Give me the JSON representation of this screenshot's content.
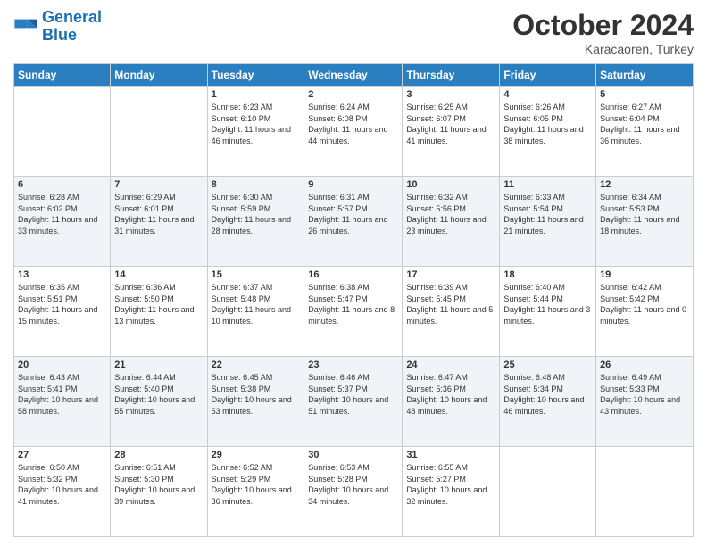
{
  "logo": {
    "line1": "General",
    "line2": "Blue"
  },
  "title": "October 2024",
  "location": "Karacaoren, Turkey",
  "days_of_week": [
    "Sunday",
    "Monday",
    "Tuesday",
    "Wednesday",
    "Thursday",
    "Friday",
    "Saturday"
  ],
  "weeks": [
    [
      {
        "day": null
      },
      {
        "day": null
      },
      {
        "day": 1,
        "sunrise": "6:23 AM",
        "sunset": "6:10 PM",
        "daylight": "11 hours and 46 minutes."
      },
      {
        "day": 2,
        "sunrise": "6:24 AM",
        "sunset": "6:08 PM",
        "daylight": "11 hours and 44 minutes."
      },
      {
        "day": 3,
        "sunrise": "6:25 AM",
        "sunset": "6:07 PM",
        "daylight": "11 hours and 41 minutes."
      },
      {
        "day": 4,
        "sunrise": "6:26 AM",
        "sunset": "6:05 PM",
        "daylight": "11 hours and 38 minutes."
      },
      {
        "day": 5,
        "sunrise": "6:27 AM",
        "sunset": "6:04 PM",
        "daylight": "11 hours and 36 minutes."
      }
    ],
    [
      {
        "day": 6,
        "sunrise": "6:28 AM",
        "sunset": "6:02 PM",
        "daylight": "11 hours and 33 minutes."
      },
      {
        "day": 7,
        "sunrise": "6:29 AM",
        "sunset": "6:01 PM",
        "daylight": "11 hours and 31 minutes."
      },
      {
        "day": 8,
        "sunrise": "6:30 AM",
        "sunset": "5:59 PM",
        "daylight": "11 hours and 28 minutes."
      },
      {
        "day": 9,
        "sunrise": "6:31 AM",
        "sunset": "5:57 PM",
        "daylight": "11 hours and 26 minutes."
      },
      {
        "day": 10,
        "sunrise": "6:32 AM",
        "sunset": "5:56 PM",
        "daylight": "11 hours and 23 minutes."
      },
      {
        "day": 11,
        "sunrise": "6:33 AM",
        "sunset": "5:54 PM",
        "daylight": "11 hours and 21 minutes."
      },
      {
        "day": 12,
        "sunrise": "6:34 AM",
        "sunset": "5:53 PM",
        "daylight": "11 hours and 18 minutes."
      }
    ],
    [
      {
        "day": 13,
        "sunrise": "6:35 AM",
        "sunset": "5:51 PM",
        "daylight": "11 hours and 15 minutes."
      },
      {
        "day": 14,
        "sunrise": "6:36 AM",
        "sunset": "5:50 PM",
        "daylight": "11 hours and 13 minutes."
      },
      {
        "day": 15,
        "sunrise": "6:37 AM",
        "sunset": "5:48 PM",
        "daylight": "11 hours and 10 minutes."
      },
      {
        "day": 16,
        "sunrise": "6:38 AM",
        "sunset": "5:47 PM",
        "daylight": "11 hours and 8 minutes."
      },
      {
        "day": 17,
        "sunrise": "6:39 AM",
        "sunset": "5:45 PM",
        "daylight": "11 hours and 5 minutes."
      },
      {
        "day": 18,
        "sunrise": "6:40 AM",
        "sunset": "5:44 PM",
        "daylight": "11 hours and 3 minutes."
      },
      {
        "day": 19,
        "sunrise": "6:42 AM",
        "sunset": "5:42 PM",
        "daylight": "11 hours and 0 minutes."
      }
    ],
    [
      {
        "day": 20,
        "sunrise": "6:43 AM",
        "sunset": "5:41 PM",
        "daylight": "10 hours and 58 minutes."
      },
      {
        "day": 21,
        "sunrise": "6:44 AM",
        "sunset": "5:40 PM",
        "daylight": "10 hours and 55 minutes."
      },
      {
        "day": 22,
        "sunrise": "6:45 AM",
        "sunset": "5:38 PM",
        "daylight": "10 hours and 53 minutes."
      },
      {
        "day": 23,
        "sunrise": "6:46 AM",
        "sunset": "5:37 PM",
        "daylight": "10 hours and 51 minutes."
      },
      {
        "day": 24,
        "sunrise": "6:47 AM",
        "sunset": "5:36 PM",
        "daylight": "10 hours and 48 minutes."
      },
      {
        "day": 25,
        "sunrise": "6:48 AM",
        "sunset": "5:34 PM",
        "daylight": "10 hours and 46 minutes."
      },
      {
        "day": 26,
        "sunrise": "6:49 AM",
        "sunset": "5:33 PM",
        "daylight": "10 hours and 43 minutes."
      }
    ],
    [
      {
        "day": 27,
        "sunrise": "6:50 AM",
        "sunset": "5:32 PM",
        "daylight": "10 hours and 41 minutes."
      },
      {
        "day": 28,
        "sunrise": "6:51 AM",
        "sunset": "5:30 PM",
        "daylight": "10 hours and 39 minutes."
      },
      {
        "day": 29,
        "sunrise": "6:52 AM",
        "sunset": "5:29 PM",
        "daylight": "10 hours and 36 minutes."
      },
      {
        "day": 30,
        "sunrise": "6:53 AM",
        "sunset": "5:28 PM",
        "daylight": "10 hours and 34 minutes."
      },
      {
        "day": 31,
        "sunrise": "6:55 AM",
        "sunset": "5:27 PM",
        "daylight": "10 hours and 32 minutes."
      },
      {
        "day": null
      },
      {
        "day": null
      }
    ]
  ]
}
